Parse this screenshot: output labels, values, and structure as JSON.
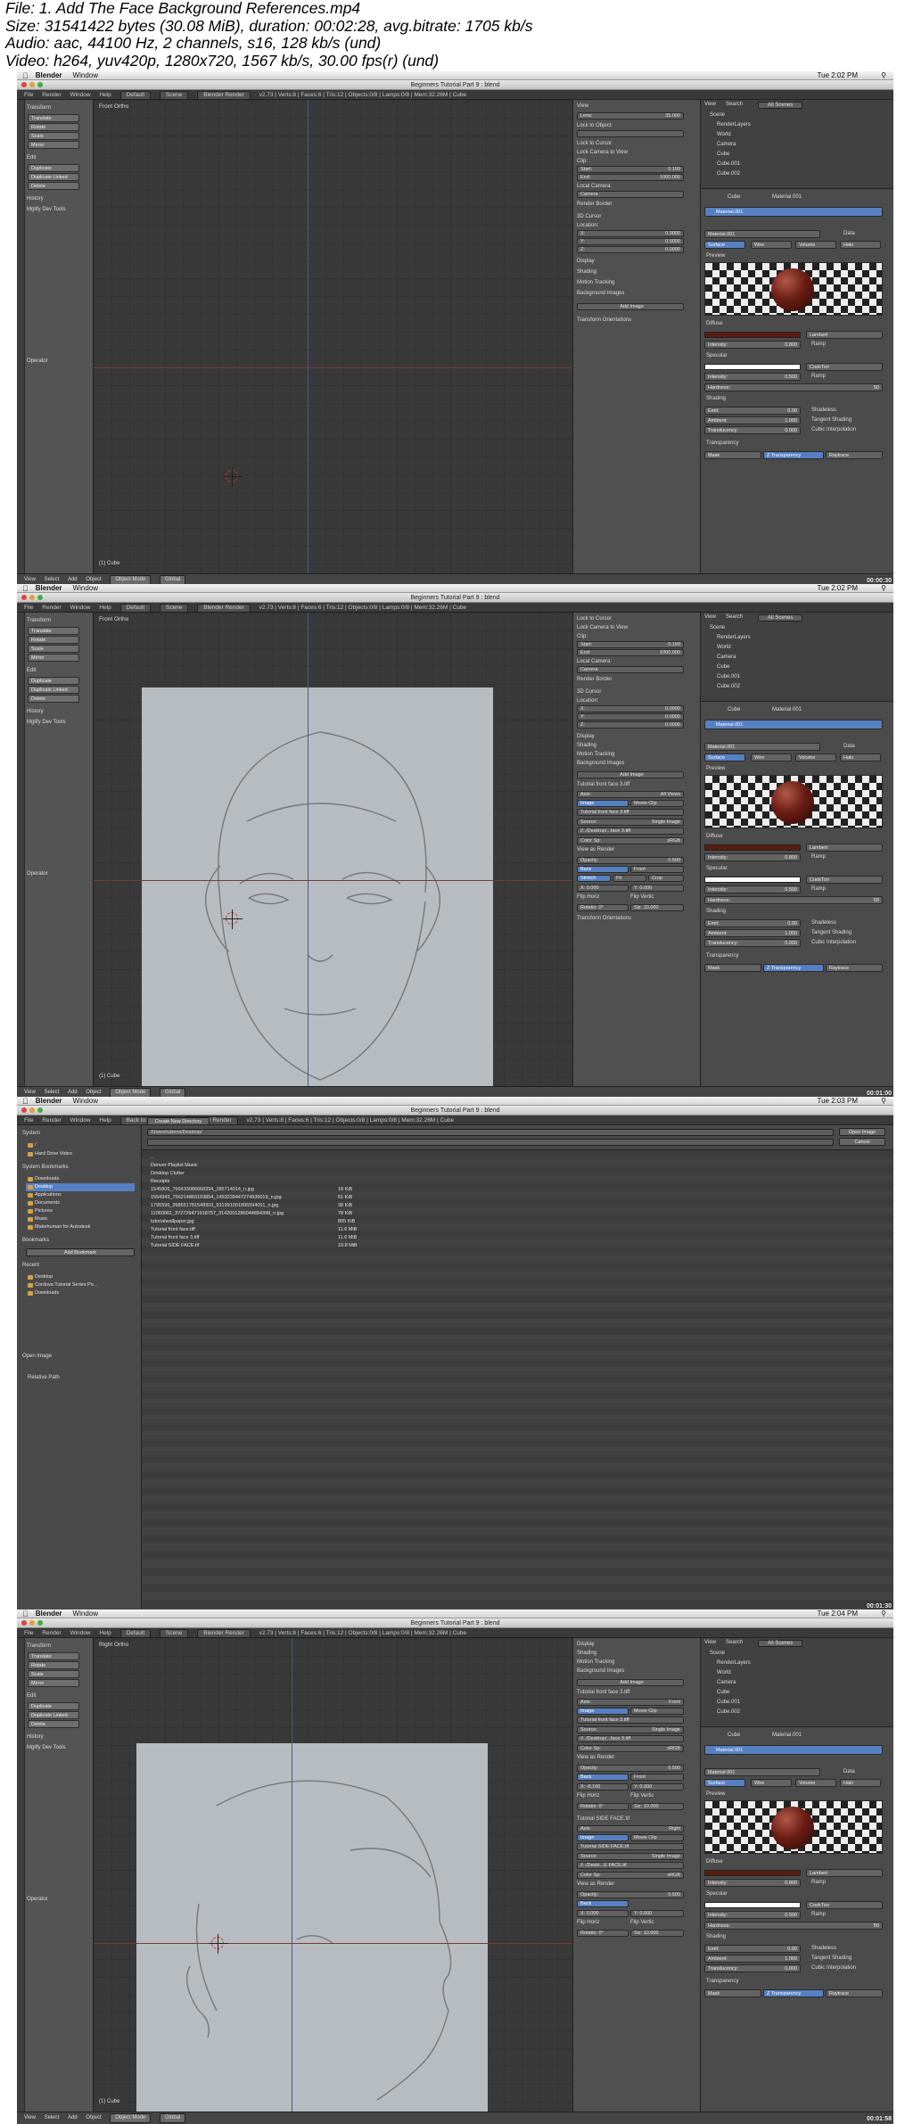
{
  "header": {
    "lines": [
      "File: 1. Add The Face Background References.mp4",
      "Size: 31541422 bytes (30.08 MiB), duration: 00:02:28, avg.bitrate: 1705 kb/s",
      "Audio: aac, 44100 Hz, 2 channels, s16, 128 kb/s (und)",
      "Video: h264, yuv420p, 1280x720, 1567 kb/s, 30.00 fps(r) (und)"
    ]
  },
  "mac": {
    "app": "Blender",
    "window_menu": "Window"
  },
  "frames": [
    {
      "time": "Tue 2:02 PM",
      "timestamp": "00:00:30",
      "view_label": "Front Ortho",
      "title": "Beginners Tutorial Part 9 : blend",
      "object_label": "(1) Cube"
    },
    {
      "time": "Tue 2:02 PM",
      "timestamp": "00:01:00",
      "view_label": "Front Ortho",
      "title": "Beginners Tutorial Part 9 : blend",
      "object_label": "(1) Cube"
    },
    {
      "time": "Tue 2:03 PM",
      "timestamp": "00:01:30",
      "view_label": "",
      "title": "Beginners Tutorial Part 9 : blend",
      "object_label": ""
    },
    {
      "time": "Tue 2:04 PM",
      "timestamp": "00:01:58",
      "view_label": "Right Ortho",
      "title": "Beginners Tutorial Part 9 : blend",
      "object_label": "(1) Cube"
    }
  ],
  "menus": {
    "file": "File",
    "render": "Render",
    "window": "Window",
    "help": "Help",
    "layout": "Default",
    "scene": "Scene",
    "engine": "Blender Render",
    "stats": "v2.73 | Verts:8 | Faces:6 | Tris:12 | Objects:0/8 | Lamps:0/8 | Mem:32.26M | Cube",
    "back": "Back to Previous"
  },
  "toolshelf": {
    "transform": "Transform",
    "translate": "Translate",
    "rotate": "Rotate",
    "scale": "Scale",
    "mirror": "Mirror",
    "edit": "Edit",
    "duplicate": "Duplicate",
    "duplicate_linked": "Duplicate Linked",
    "delete": "Delete",
    "history": "History",
    "mglyph": "Mglify Dev Tools",
    "operator": "Operator"
  },
  "npanel": {
    "view": "View",
    "lens": "Lens:",
    "lens_val": "35.000",
    "lock_to_object": "Lock to Object:",
    "lock_cursor": "Lock to Cursor",
    "lock_camera": "Lock Camera to View",
    "clip": "Clip:",
    "start": "Start:",
    "start_val": "0.100",
    "end": "End:",
    "end_val": "1000.000",
    "local_camera": "Local Camera:",
    "camera": "Camera",
    "render_border": "Render Border",
    "cursor_3d": "3D Cursor",
    "location": "Location:",
    "x": "X:",
    "y": "Y:",
    "z": "Z:",
    "zero": "0.0000",
    "display": "Display",
    "shading": "Shading",
    "motion_tracking": "Motion Tracking",
    "background_images": "Background Images",
    "add_image": "Add Image",
    "transform_orientations": "Transform Orientations",
    "bg1": "Tutorial front face 3.tiff",
    "axis": "Axis:",
    "all_views": "All Views",
    "front": "Front",
    "right": "Right",
    "image": "Image",
    "movie_clip": "Movie Clip",
    "source": "Source:",
    "single_image": "Single Image",
    "filepath": "//../Desktop/...face 3.tiff",
    "color_space": "Color Sp:",
    "srgb": "sRGB",
    "view_as_render": "View as Render",
    "opacity": "Opacity:",
    "opacity_val": "0.500",
    "back": "Back",
    "stretch": "Stretch",
    "fit": "Fit",
    "crop": "Crop",
    "flip_h": "Flip Horiz",
    "flip_v": "Flip Vertic",
    "rotation": "Rotatio: 0°",
    "size": "Siz: 10.000",
    "bg2": "Tutorial SIDE FACE.tif",
    "filepath2": "//../Deskt...E FACE.tif",
    "x_val": "X: 0.000",
    "y_val": "Y: 0.000",
    "x_val2": "X: -0.100"
  },
  "outliner": {
    "view": "View",
    "search": "Search",
    "all_scenes": "All Scenes",
    "scene": "Scene",
    "renderlayers": "RenderLayers",
    "world": "World",
    "camera": "Camera",
    "cube": "Cube",
    "cube001": "Cube.001",
    "cube002": "Cube.002"
  },
  "props": {
    "cube": "Cube",
    "material": "Material.001",
    "data": "Data",
    "surface": "Surface",
    "wire": "Wire",
    "volume": "Volume",
    "halo": "Halo",
    "preview": "Preview",
    "diffuse": "Diffuse",
    "lambert": "Lambert",
    "intensity": "Intensity:",
    "diffuse_int": "0.800",
    "ramp": "Ramp",
    "specular": "Specular",
    "cooktorr": "CookTorr",
    "spec_int": "0.500",
    "hardness": "Hardness:",
    "hardness_val": "50",
    "shading": "Shading",
    "emit": "Emit:",
    "emit_val": "0.00",
    "shadeless": "Shadeless",
    "ambient": "Ambient:",
    "ambient_val": "1.000",
    "tangent": "Tangent Shading",
    "translucency": "Translucency:",
    "transl_val": "0.000",
    "cubic": "Cubic Interpolation",
    "transparency": "Transparency",
    "mask": "Mask",
    "ztransp": "Z Transparency",
    "raytrace": "Raytrace",
    "diffuse_color": "#5a1c12",
    "spec_color": "#ffffff"
  },
  "bottom": {
    "view": "View",
    "select": "Select",
    "add": "Add",
    "object": "Object",
    "mode": "Object Mode",
    "global": "Global"
  },
  "filebrowser": {
    "system": "System",
    "sys_root": "/",
    "hard_drive": "Hard Drive Video",
    "system_bookmarks": "System Bookmarks",
    "sysbm": [
      "Downloads",
      "Desktop",
      "Applications",
      "Documents",
      "Pictures",
      "Music",
      "Makehuman for Autodesk"
    ],
    "bookmarks": "Bookmarks",
    "add_bookmark": "Add Bookmark",
    "recent": "Recent",
    "recent_items": [
      "Desktop",
      "Cordova Tutorial Series Po...",
      "Downloads"
    ],
    "open_image": "Open Image",
    "relative_path": "Relative Path",
    "path": "/Users/rubens/Desktop/",
    "open_btn": "Open Image",
    "cancel_btn": "Cancel",
    "create_dir": "Create New Directory",
    "files": [
      {
        "name": "..",
        "size": ""
      },
      {
        "name": "Denver Playlist Music",
        "size": ""
      },
      {
        "name": "Desktop Clutter",
        "size": ""
      },
      {
        "name": "Receipts",
        "size": ""
      },
      {
        "name": "1545806_766433086668394_285714014_n.jpg",
        "size": "18 KiB"
      },
      {
        "name": "1554343_756214860103854_1453239447274939019_n.jpg",
        "size": "51 KiB"
      },
      {
        "name": "1795596_998651781548303_931991001895594051_n.jpg",
        "size": "38 KiB"
      },
      {
        "name": "11060061_372729471918757_3142001286044894398_n.jpg",
        "size": "78 KiB"
      },
      {
        "name": "tutorialwallpaper.jpg",
        "size": "895 KiB"
      },
      {
        "name": "Tutorial front face.tiff",
        "size": "11.6 MiB"
      },
      {
        "name": "Tutorial front face 3.tiff",
        "size": "11.6 MiB"
      },
      {
        "name": "Tutorial SIDE FACE.tif",
        "size": "10.8 MiB"
      }
    ]
  }
}
